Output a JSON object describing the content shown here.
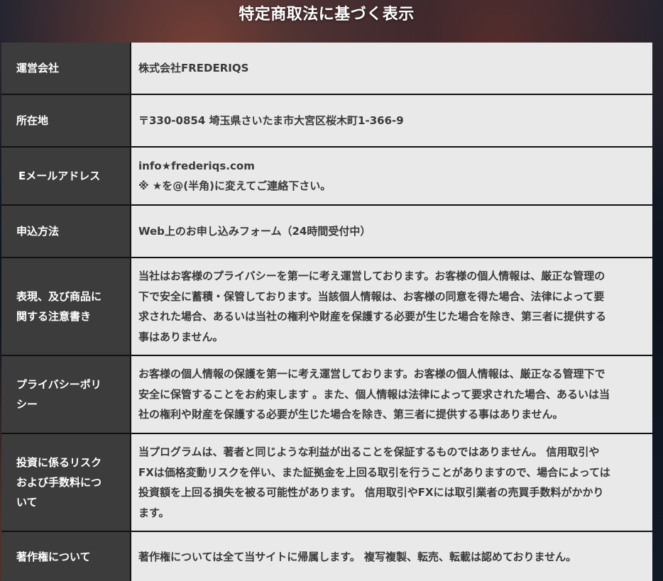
{
  "page": {
    "title": "特定商取法に基づく表示"
  },
  "rows": [
    {
      "label": "運営会社",
      "value_lines": [
        "株式会社FREDERIQS"
      ]
    },
    {
      "label": "所在地",
      "value_lines": [
        "〒330-0854 埼玉県さいたま市大宮区桜木町1-366-9"
      ]
    },
    {
      "label": "Eメールアドレス",
      "value_lines": [
        "info★frederiqs.com",
        "※ ★を@(半角)に変えてご連絡下さい。"
      ]
    },
    {
      "label": "申込方法",
      "value_lines": [
        "Web上のお申し込みフォーム（24時間受付中）"
      ]
    },
    {
      "label_lines": [
        "表現、及び商品に",
        "関する注意書き"
      ],
      "value_lines": [
        "当社はお客様のプライバシーを第一に考え運営しております。お客様の個人情報は、厳正な管理の",
        "下で安全に蓄積・保管しております。当該個人情報は、お客様の同意を得た場合、法律によって要",
        "求された場合、あるいは当社の権利や財産を保護する必要が生じた場合を除き、第三者に提供する",
        "事はありません。"
      ]
    },
    {
      "label_lines": [
        "プライバシーポリ",
        "シー"
      ],
      "value_lines": [
        "お客様の個人情報の保護を第一に考え運営しております。お客様の個人情報は、厳正なる管理下で",
        "安全に保管することをお約束します 。また、個人情報は法律によって要求された場合、あるいは当",
        "社の権利や財産を保護する必要が生じた場合を除き、第三者に提供する事はありません。"
      ]
    },
    {
      "label_lines": [
        "投資に係るリスク",
        "および手数料につ",
        "いて"
      ],
      "value_lines": [
        "当プログラムは、著者と同じような利益が出ることを保証するものではありません。 信用取引や",
        "FXは価格変動リスクを伴い、また証拠金を上回る取引を行うことがありますので、場合によっては",
        "投資額を上回る損失を被る可能性があります。 信用取引やFXには取引業者の売買手数料がかかり",
        "ます。"
      ]
    },
    {
      "label": "著作権について",
      "value_lines": [
        "著作権については全て当サイトに帰属します。 複写複製、転売、転載は認めておりません。"
      ]
    }
  ]
}
